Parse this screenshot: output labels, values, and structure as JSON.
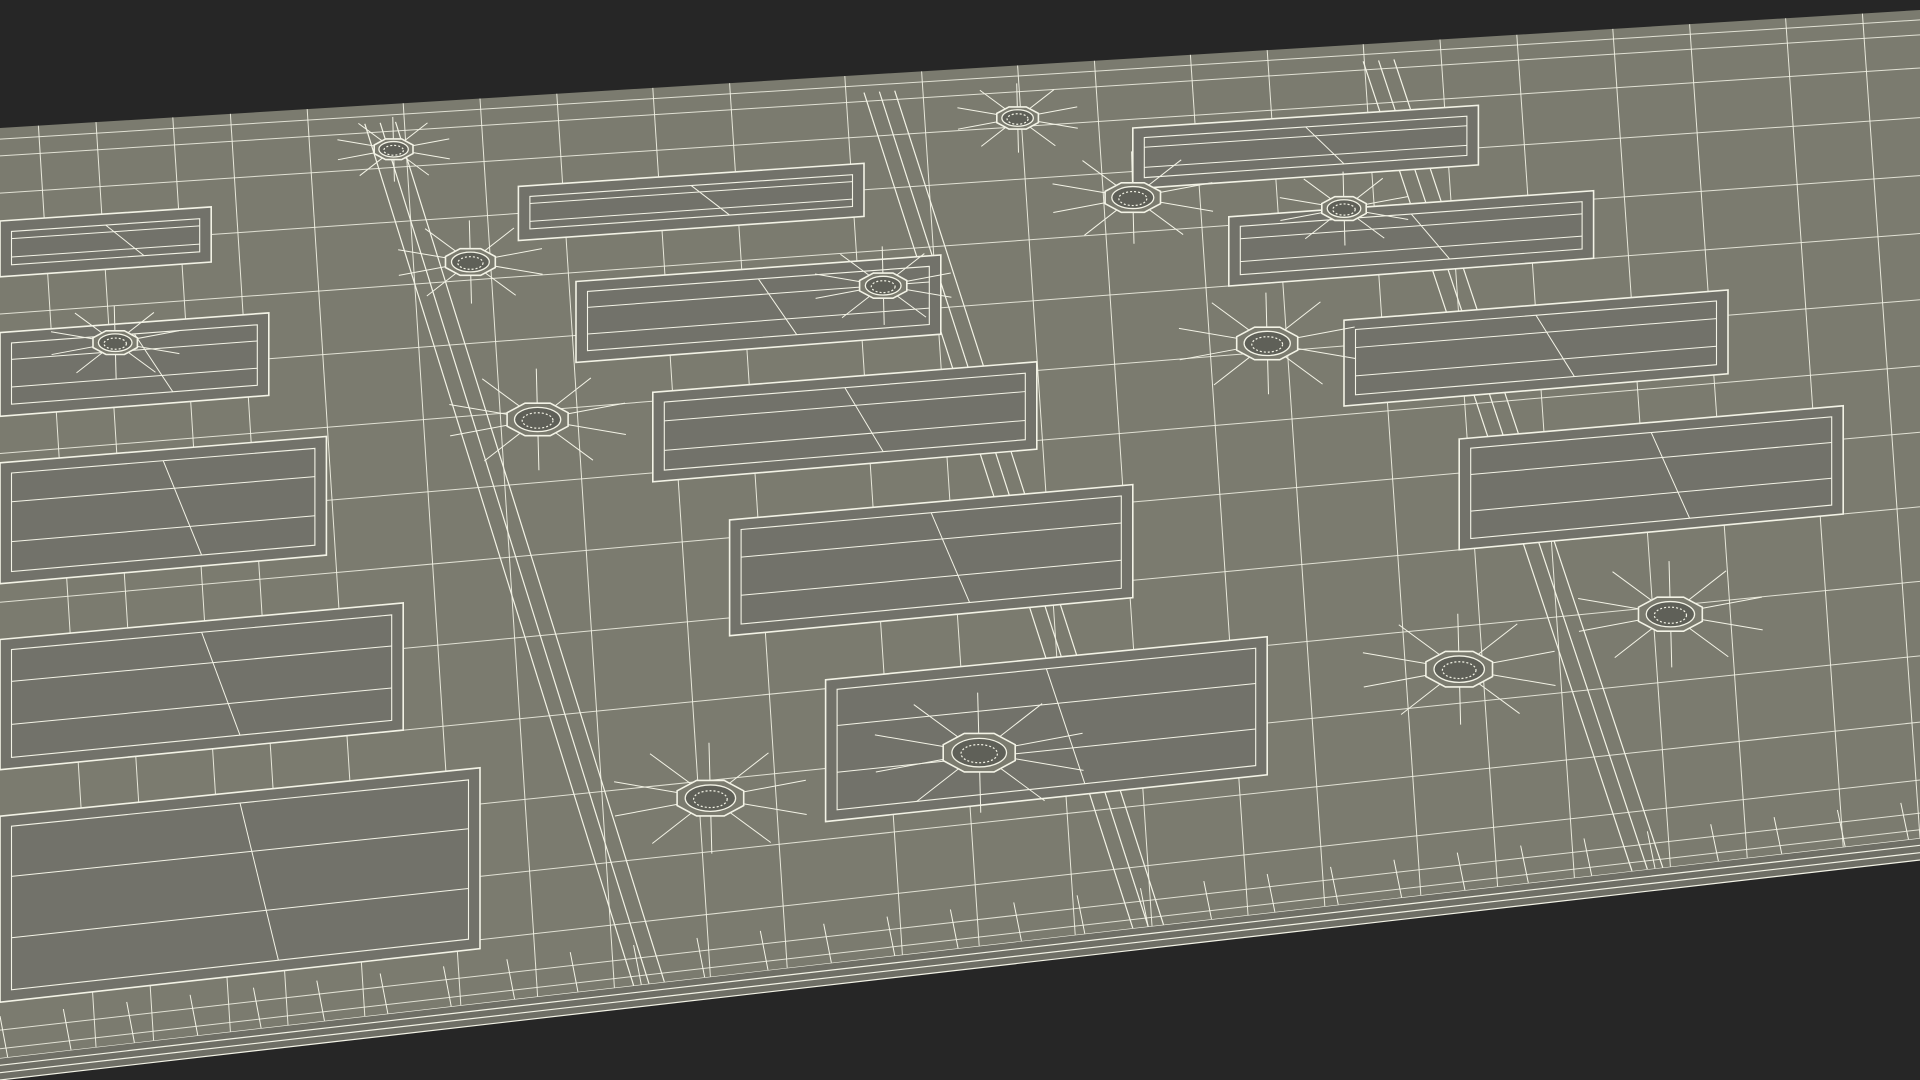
{
  "scene": {
    "subject": "",
    "render_mode": "wireframe",
    "colors": {
      "background": "#262626",
      "surface": "#7b7b6f",
      "surface_shade": "#72726a",
      "slab_edge": "#6f6f66",
      "wire": "#f3f3e6",
      "hole": "#5f6058"
    },
    "screen_panels": 14,
    "vents": 13
  }
}
